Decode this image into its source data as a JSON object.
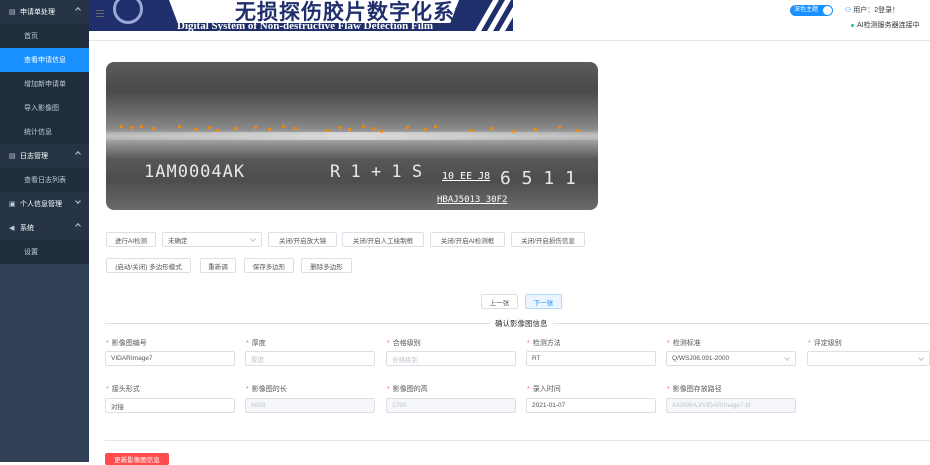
{
  "sidebar": {
    "groups": [
      {
        "label": "申请单处理",
        "items": [
          "首页",
          "查看申请信息",
          "增加新申请单",
          "导入影像图",
          "统计信息"
        ]
      },
      {
        "label": "日志管理",
        "items": [
          "查看日志列表"
        ]
      },
      {
        "label": "个人信息管理",
        "items": []
      },
      {
        "label": "系统",
        "items": [
          "设置"
        ]
      }
    ],
    "active_item": "查看申请信息"
  },
  "header": {
    "title_cn": "无损探伤胶片数字化系统",
    "title_en": "Digital System of Non-destructive Flaw Detection Film",
    "theme_toggle": "深色主题",
    "user_text": "用户：2登录！",
    "ai_status": "AI检测服务器连接中"
  },
  "film": {
    "text_main": "1AM0004AK",
    "text_mid": "R 1 + 1 S",
    "text_stamp": "10 EE J8",
    "text_num": "6 5 1 1",
    "text_bottom": "HBAJ5013 30F2",
    "marker_color": "#ff8c00"
  },
  "toolbar": {
    "ai_detect": "进行AI检测",
    "select_value": "未确定",
    "toggle_magnifier": "关闭/开启放大镜",
    "toggle_manual_box": "关闭/开启人工绘制框",
    "toggle_ai_box": "关闭/开启AI检测框",
    "toggle_damage_info": "关闭/开启损伤信息",
    "polygon_mode": "(启动/关闭) 多边形模式",
    "redraw": "重新调",
    "save_polygon": "保存多边形",
    "delete_polygon": "删除多边形"
  },
  "pager": {
    "prev": "上一张",
    "next": "下一张"
  },
  "section_title": "确认影像图信息",
  "form": {
    "row1": [
      {
        "label": "影像图编号",
        "value": "VIDARImage7",
        "placeholder": ""
      },
      {
        "label": "厚度",
        "value": "",
        "placeholder": "厚度"
      },
      {
        "label": "合格级别",
        "value": "",
        "placeholder": "合格级别"
      },
      {
        "label": "检测方法",
        "value": "RT",
        "placeholder": ""
      },
      {
        "label": "检测标准",
        "value": "Q/WSJ06.091-2000",
        "placeholder": ""
      },
      {
        "label": "评定级别",
        "value": "",
        "placeholder": ""
      }
    ],
    "row2": [
      {
        "label": "接头形式",
        "value": "对接"
      },
      {
        "label": "影像图的长",
        "value": "6836"
      },
      {
        "label": "影像图的高",
        "value": "1750"
      },
      {
        "label": "录入时间",
        "value": "2021-01-07"
      },
      {
        "label": "影像图存放路径",
        "value": "AI0006AJ/VIDARImage7.tif"
      }
    ]
  },
  "footer_button": "更新影像图信息",
  "colors": {
    "sidebar_bg": "#304156",
    "accent": "#1890ff",
    "danger": "#ff4d4f",
    "banner": "#1f2f6b"
  }
}
